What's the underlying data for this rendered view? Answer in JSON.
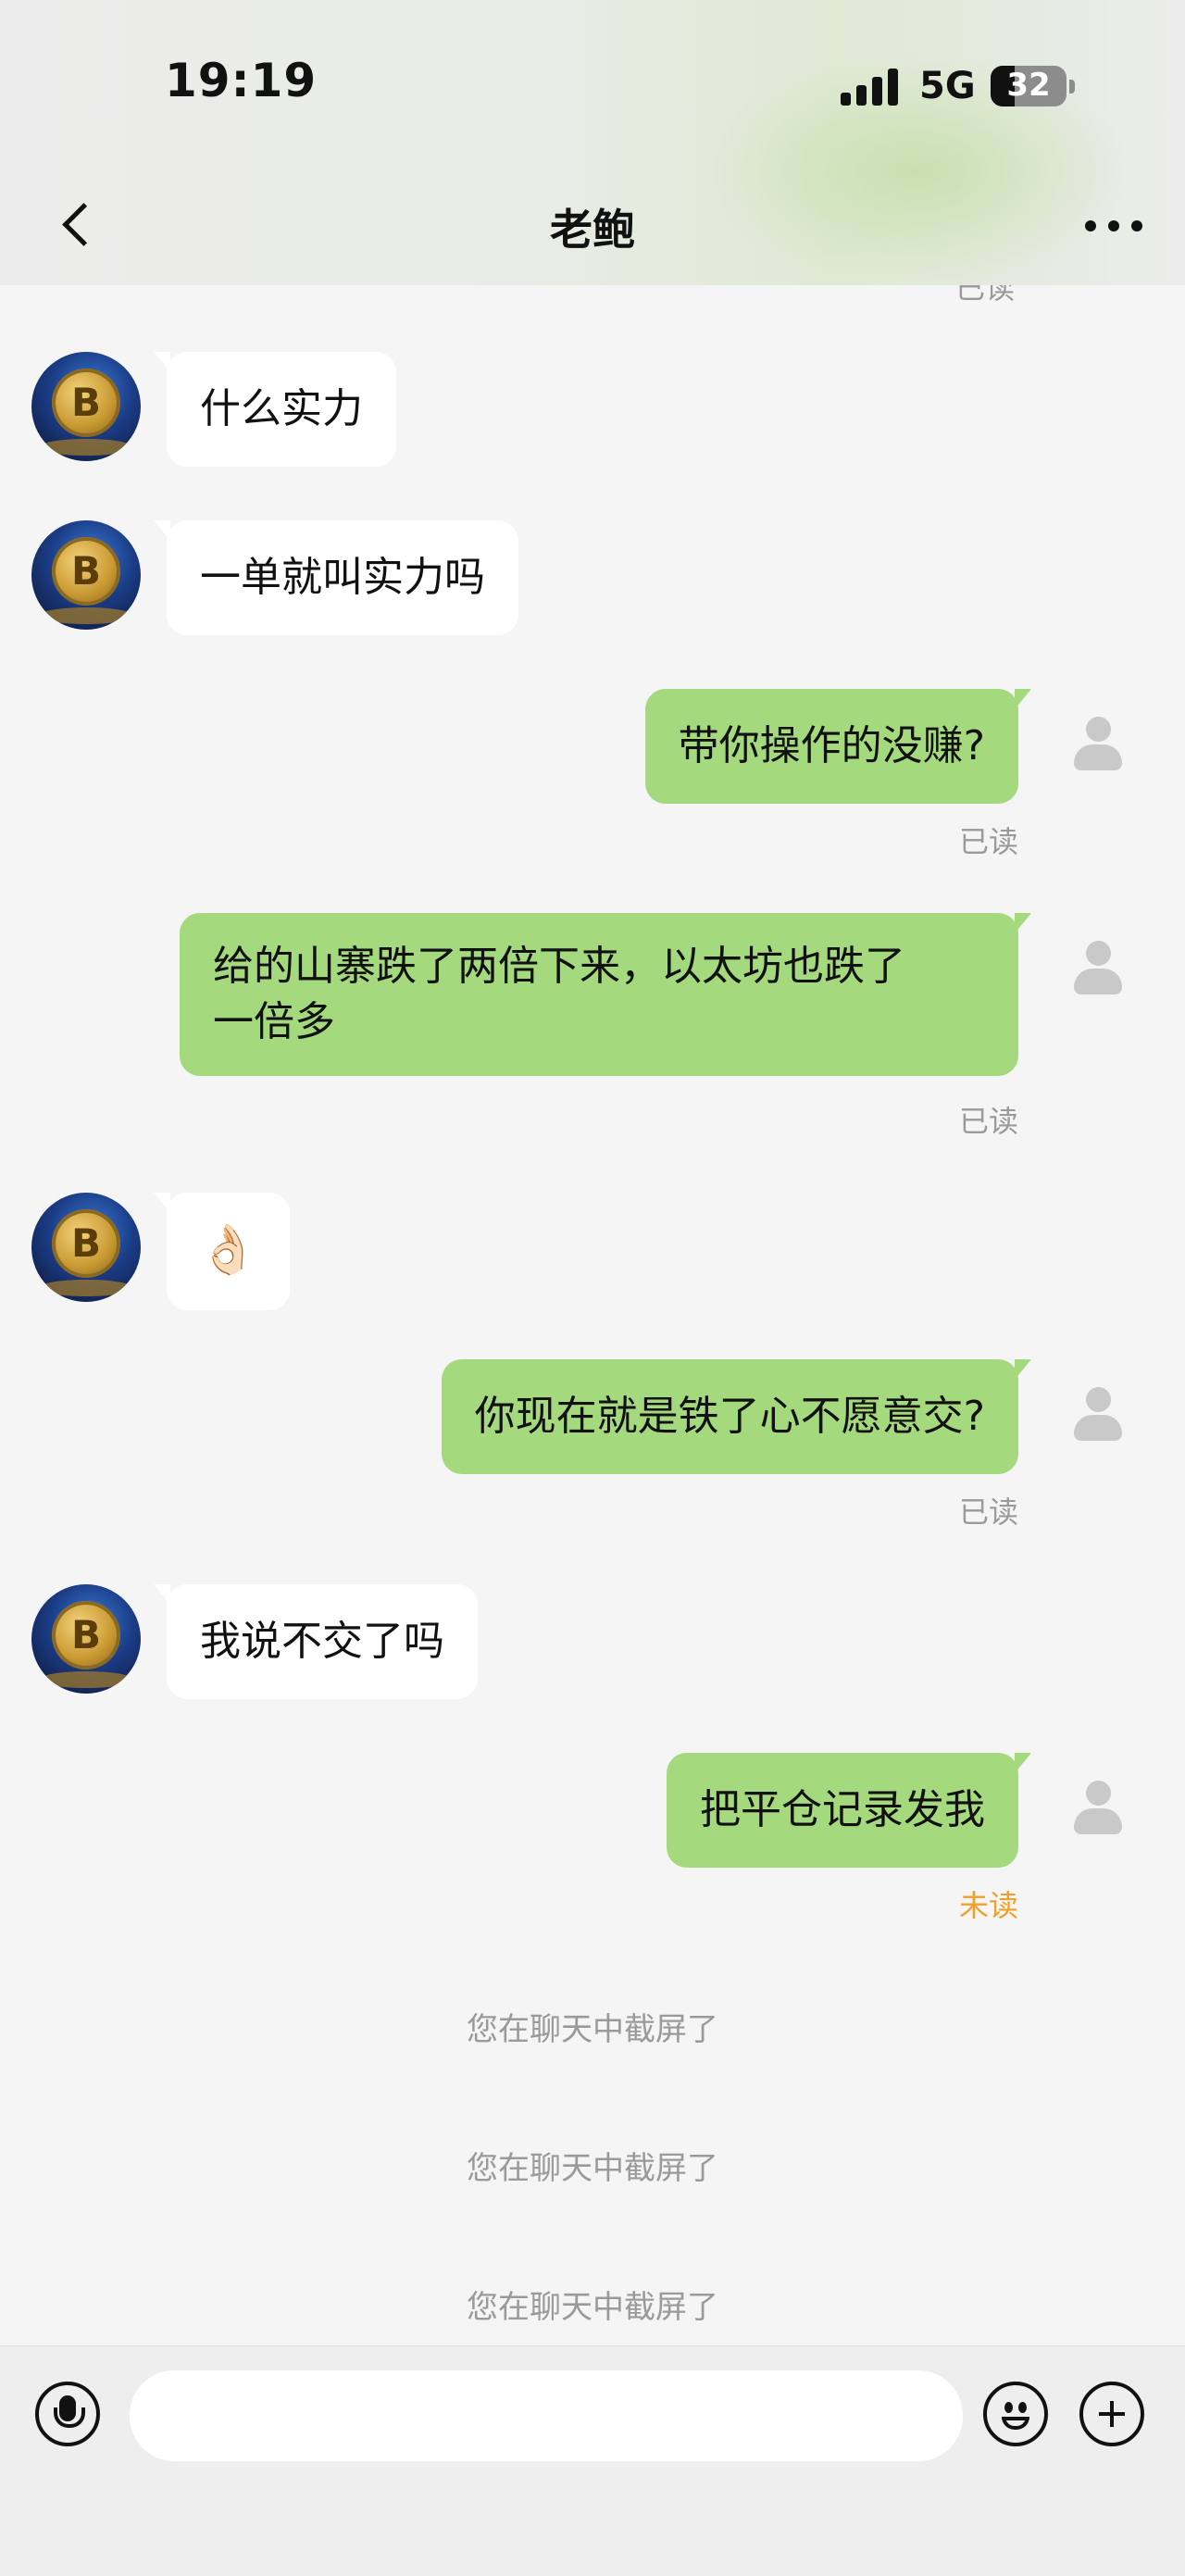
{
  "status_bar": {
    "time": "19:19",
    "network": "5G",
    "battery_level": 32
  },
  "header": {
    "title": "老鲍"
  },
  "chat": {
    "top_read_label": "已读",
    "messages": [
      {
        "side": "in",
        "text": "什么实力"
      },
      {
        "side": "in",
        "text": "一单就叫实力吗"
      },
      {
        "side": "out",
        "text": "带你操作的没赚?",
        "status": "已读"
      },
      {
        "side": "out",
        "line1": "给的山寨跌了两倍下来，以太坊也跌了",
        "line2": "一倍多",
        "status": "已读"
      },
      {
        "side": "in",
        "emoji": "👌🏻"
      },
      {
        "side": "out",
        "text": "你现在就是铁了心不愿意交?",
        "status": "已读"
      },
      {
        "side": "in",
        "text": "我说不交了吗"
      },
      {
        "side": "out",
        "text": "把平仓记录发我",
        "status": "未读"
      }
    ],
    "system_notices": [
      "您在聊天中截屏了",
      "您在聊天中截屏了",
      "您在聊天中截屏了"
    ]
  },
  "input_bar": {
    "message_value": ""
  },
  "colors": {
    "outgoing_bubble": "#a5d97e",
    "incoming_bubble": "#ffffff",
    "unread": "#f0a02a"
  }
}
